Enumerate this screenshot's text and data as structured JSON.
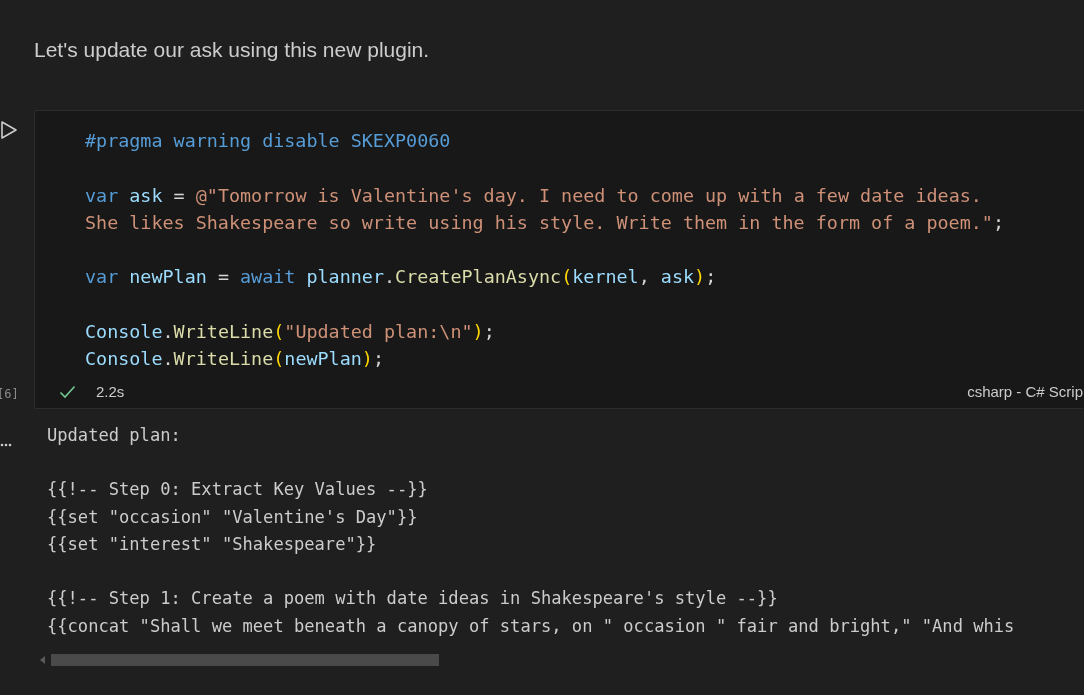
{
  "markdown": {
    "text": "Let's update our ask using this new plugin."
  },
  "cell": {
    "execution_count": "[6]",
    "succeeded": true,
    "duration": "2.2s",
    "language": "csharp - C# Scrip",
    "lines": [
      {
        "kind": "code",
        "tokens": [
          {
            "kind": "directive",
            "text": "#pragma warning disable SKEXP0060"
          }
        ]
      },
      {
        "kind": "blank"
      },
      {
        "kind": "code",
        "tokens": [
          {
            "kind": "keyword",
            "text": "var "
          },
          {
            "kind": "variable",
            "text": "ask"
          },
          {
            "kind": "plain",
            "text": " = "
          },
          {
            "kind": "string",
            "text": "@\"Tomorrow is Valentine's day. I need to come up with a few date ideas."
          }
        ]
      },
      {
        "kind": "code",
        "tokens": [
          {
            "kind": "string",
            "text": "She likes Shakespeare so write using his style. Write them in the form of a poem.\""
          },
          {
            "kind": "plain",
            "text": ";"
          }
        ]
      },
      {
        "kind": "blank"
      },
      {
        "kind": "code",
        "tokens": [
          {
            "kind": "keyword",
            "text": "var "
          },
          {
            "kind": "variable",
            "text": "newPlan"
          },
          {
            "kind": "plain",
            "text": " = "
          },
          {
            "kind": "keyword",
            "text": "await "
          },
          {
            "kind": "variable",
            "text": "planner"
          },
          {
            "kind": "plain",
            "text": "."
          },
          {
            "kind": "function",
            "text": "CreatePlanAsync"
          },
          {
            "kind": "paren",
            "text": "("
          },
          {
            "kind": "variable",
            "text": "kernel"
          },
          {
            "kind": "plain",
            "text": ", "
          },
          {
            "kind": "variable",
            "text": "ask"
          },
          {
            "kind": "paren",
            "text": ")"
          },
          {
            "kind": "plain",
            "text": ";"
          }
        ]
      },
      {
        "kind": "blank"
      },
      {
        "kind": "code",
        "tokens": [
          {
            "kind": "variable",
            "text": "Console"
          },
          {
            "kind": "plain",
            "text": "."
          },
          {
            "kind": "function",
            "text": "WriteLine"
          },
          {
            "kind": "paren",
            "text": "("
          },
          {
            "kind": "string",
            "text": "\"Updated plan:\\n\""
          },
          {
            "kind": "paren",
            "text": ")"
          },
          {
            "kind": "plain",
            "text": ";"
          }
        ]
      },
      {
        "kind": "code",
        "tokens": [
          {
            "kind": "variable",
            "text": "Console"
          },
          {
            "kind": "plain",
            "text": "."
          },
          {
            "kind": "function",
            "text": "WriteLine"
          },
          {
            "kind": "paren",
            "text": "("
          },
          {
            "kind": "variable",
            "text": "newPlan"
          },
          {
            "kind": "paren",
            "text": ")"
          },
          {
            "kind": "plain",
            "text": ";"
          }
        ]
      }
    ]
  },
  "output": {
    "lines": [
      {
        "kind": "text",
        "text": "Updated plan:"
      },
      {
        "kind": "blank"
      },
      {
        "kind": "text",
        "text": "{{!-- Step 0: Extract Key Values --}}"
      },
      {
        "kind": "text",
        "text": "{{set \"occasion\" \"Valentine's Day\"}}"
      },
      {
        "kind": "text",
        "text": "{{set \"interest\" \"Shakespeare\"}}"
      },
      {
        "kind": "blank"
      },
      {
        "kind": "text",
        "text": "{{!-- Step 1: Create a poem with date ideas in Shakespeare's style --}}"
      },
      {
        "kind": "text",
        "text": "{{concat \"Shall we meet beneath a canopy of stars, on \" occasion \" fair and bright,\" \"And whis"
      }
    ]
  }
}
